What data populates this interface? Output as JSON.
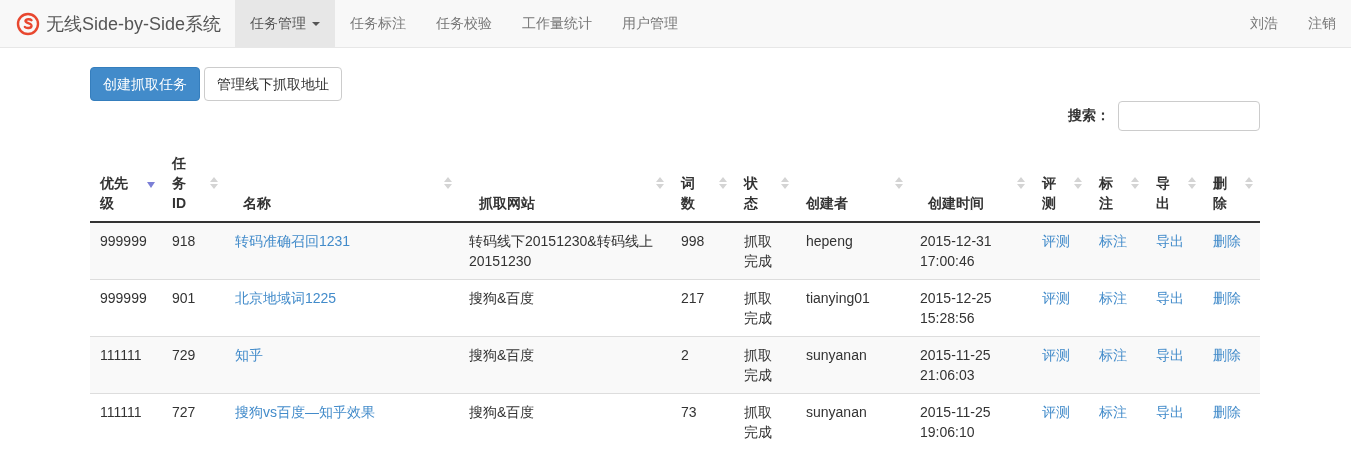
{
  "navbar": {
    "brand": "无线Side-by-Side系统",
    "items": [
      {
        "label": "任务管理",
        "selected": true,
        "dropdown": true
      },
      {
        "label": "任务标注",
        "selected": false,
        "dropdown": false
      },
      {
        "label": "任务校验",
        "selected": false,
        "dropdown": false
      },
      {
        "label": "工作量统计",
        "selected": false,
        "dropdown": false
      },
      {
        "label": "用户管理",
        "selected": false,
        "dropdown": false
      }
    ],
    "right_items": [
      "刘浩",
      "注销"
    ]
  },
  "toolbar": {
    "buttons": [
      {
        "label": "创建抓取任务",
        "kind": "primary"
      },
      {
        "label": "管理线下抓取地址",
        "kind": "default"
      }
    ],
    "search": {
      "label": "搜索："
    }
  },
  "table": {
    "columns": [
      {
        "label": "优先级",
        "sorted": true
      },
      {
        "label": "任务ID",
        "sorted": false
      },
      {
        "label": "名称",
        "sorted": false
      },
      {
        "label": "抓取网站",
        "sorted": false
      },
      {
        "label": "词数",
        "sorted": false
      },
      {
        "label": "状态",
        "sorted": false
      },
      {
        "label": "创建者",
        "sorted": false
      },
      {
        "label": "创建时间",
        "sorted": false
      },
      {
        "label": "评测",
        "sorted": false
      },
      {
        "label": "标注",
        "sorted": false
      },
      {
        "label": "导出",
        "sorted": false
      },
      {
        "label": "删除",
        "sorted": false
      }
    ],
    "rows": [
      {
        "priority": "999999",
        "id": "918",
        "name": "转码准确召回1231",
        "site": "转码线下20151230&转码线上20151230",
        "count": "998",
        "status": "抓取完成",
        "creator": "hepeng",
        "created": "2015-12-31 17:00:46",
        "actions": [
          "评测",
          "标注",
          "导出",
          "删除"
        ]
      },
      {
        "priority": "999999",
        "id": "901",
        "name": "北京地域词1225",
        "site": "搜狗&百度",
        "count": "217",
        "status": "抓取完成",
        "creator": "tianying01",
        "created": "2015-12-25 15:28:56",
        "actions": [
          "评测",
          "标注",
          "导出",
          "删除"
        ]
      },
      {
        "priority": "111111",
        "id": "729",
        "name": "知乎",
        "site": "搜狗&百度",
        "count": "2",
        "status": "抓取完成",
        "creator": "sunyanan",
        "created": "2015-11-25 21:06:03",
        "actions": [
          "评测",
          "标注",
          "导出",
          "删除"
        ]
      },
      {
        "priority": "111111",
        "id": "727",
        "name": "搜狗vs百度—知乎效果",
        "site": "搜狗&百度",
        "count": "73",
        "status": "抓取完成",
        "creator": "sunyanan",
        "created": "2015-11-25 19:06:10",
        "actions": [
          "评测",
          "标注",
          "导出",
          "删除"
        ]
      }
    ]
  }
}
